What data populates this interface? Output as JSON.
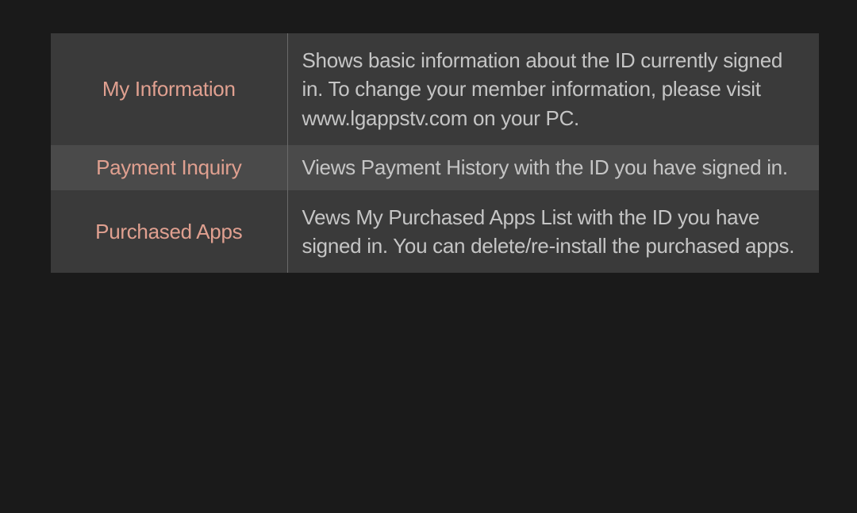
{
  "rows": [
    {
      "label": "My Information",
      "description": "Shows basic information about the ID currently signed in. To change your member information, please visit www.lgappstv.com on your PC."
    },
    {
      "label": "Payment Inquiry",
      "description": "Views Payment History with the ID you have signed in."
    },
    {
      "label": "Purchased Apps",
      "description": "Vews My Purchased Apps List with the ID you have signed in. You can delete/re-install the purchased apps."
    }
  ]
}
